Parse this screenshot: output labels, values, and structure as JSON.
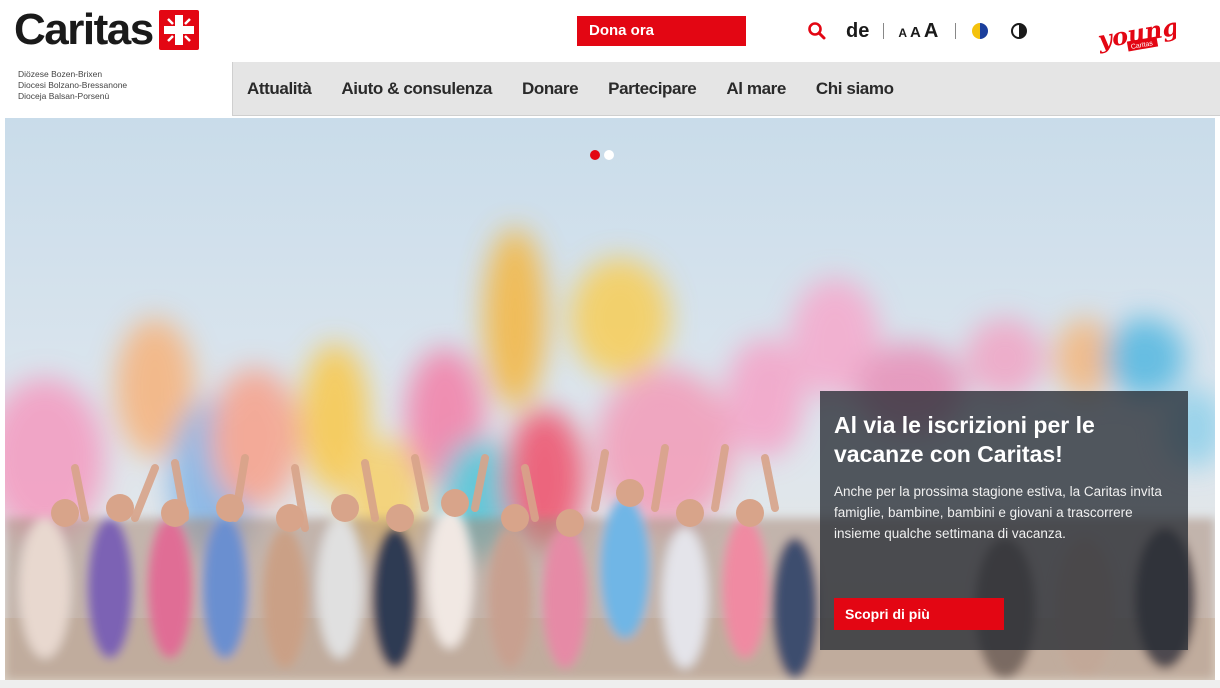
{
  "header": {
    "logo_text": "Caritas",
    "donate_label": "Dona ora",
    "language": "de",
    "text_size_labels": [
      "A",
      "A",
      "A"
    ],
    "young_logo": {
      "word": "young",
      "sub": "Caritas"
    }
  },
  "diocese": {
    "lines": [
      "Diözese Bozen-Brixen",
      "Diocesi Bolzano-Bressanone",
      "Dioceja Balsan-Porsenù"
    ]
  },
  "nav": {
    "items": [
      "Attualità",
      "Aiuto & consulenza",
      "Donare",
      "Partecipare",
      "Al mare",
      "Chi siamo"
    ]
  },
  "hero": {
    "slides_total": 2,
    "active_slide": 1,
    "title": "Al via le iscrizioni per le vacanze con Caritas!",
    "text": "Anche per la prossima stagione estiva, la Caritas invita famiglie, bambine, bambini e giovani a trascorrere insieme qualche settimana di vacanza.",
    "button_label": "Scopri di più"
  },
  "icons": {
    "search": "search-icon",
    "colors": "color-scheme-icon",
    "contrast": "contrast-icon",
    "logo_cross": "caritas-cross-icon"
  },
  "colors": {
    "brand_red": "#e30613",
    "nav_bg": "#e5e5e5",
    "caption_bg": "#282d34"
  }
}
